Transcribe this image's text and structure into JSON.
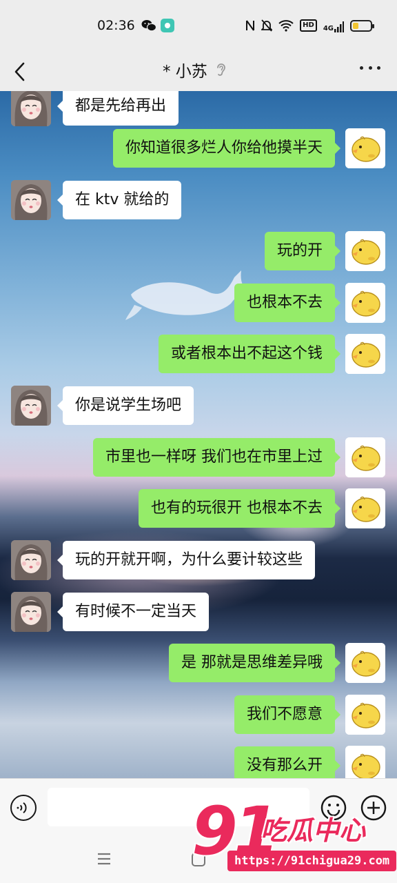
{
  "status_bar": {
    "time": "02:36",
    "hd_label": "HD",
    "network_label": "4G"
  },
  "nav": {
    "title": "* 小苏"
  },
  "messages": [
    {
      "side": "left",
      "text": "都是先给再出"
    },
    {
      "side": "right",
      "text": "你知道很多烂人你给他摸半天"
    },
    {
      "side": "left",
      "text": "在 ktv 就给的"
    },
    {
      "side": "right",
      "text": "玩的开"
    },
    {
      "side": "right",
      "text": "也根本不去"
    },
    {
      "side": "right",
      "text": "或者根本出不起这个钱"
    },
    {
      "side": "left",
      "text": "你是说学生场吧"
    },
    {
      "side": "right",
      "text": "市里也一样呀 我们也在市里上过"
    },
    {
      "side": "right",
      "text": "也有的玩很开  也根本不去"
    },
    {
      "side": "left",
      "text": "玩的开就开啊，为什么要计较这些"
    },
    {
      "side": "left",
      "text": "有时候不一定当天"
    },
    {
      "side": "right",
      "text": "是  那就是思维差异哦"
    },
    {
      "side": "right",
      "text": "我们不愿意"
    },
    {
      "side": "right",
      "text": "没有那么开"
    }
  ],
  "input": {
    "value": ""
  },
  "watermark": {
    "number": "91",
    "name": "吃瓜中心",
    "url": "https://91chigua29.com"
  },
  "colors": {
    "sent_bubble": "#95ec69",
    "received_bubble": "#ffffff",
    "watermark": "#ea2a5c"
  }
}
